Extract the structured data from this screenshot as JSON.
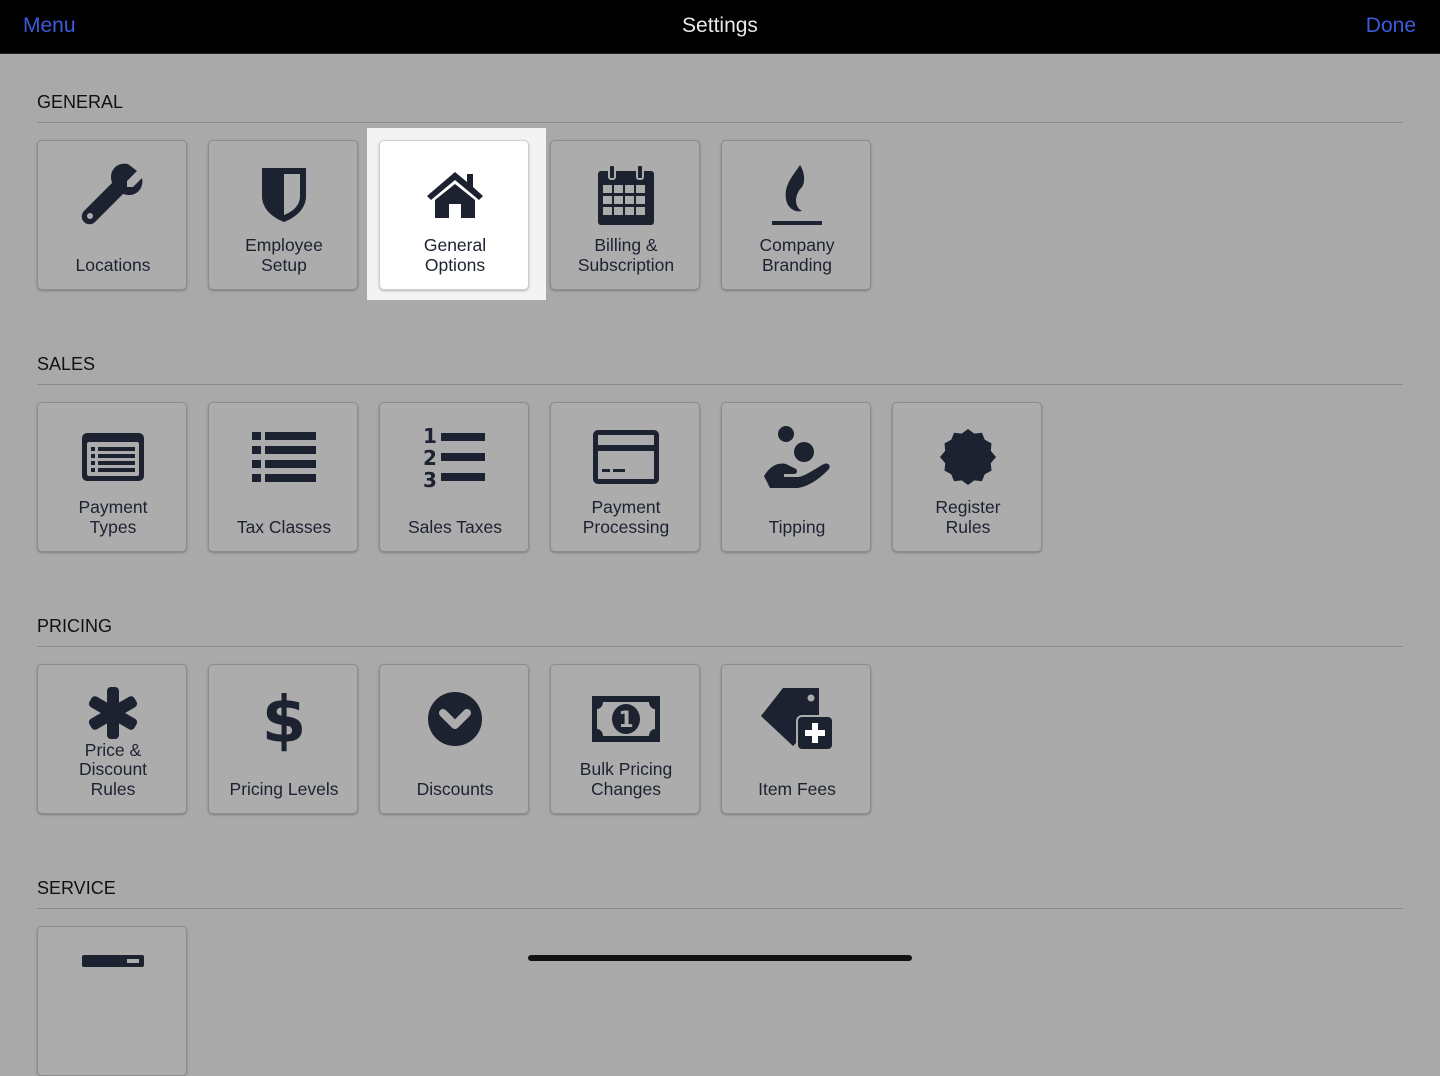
{
  "header": {
    "menu_label": "Menu",
    "title": "Settings",
    "done_label": "Done"
  },
  "colors": {
    "accent": "#3b5bd9",
    "icon": "#1d2230",
    "background": "#a9a9a9"
  },
  "sections": {
    "general": {
      "title": "GENERAL",
      "items": [
        {
          "label": "Locations",
          "icon": "wrench-icon"
        },
        {
          "label": "Employee\nSetup",
          "icon": "shield-icon"
        },
        {
          "label": "General\nOptions",
          "icon": "home-icon",
          "selected": true
        },
        {
          "label": "Billing &\nSubscription",
          "icon": "calendar-icon"
        },
        {
          "label": "Company\nBranding",
          "icon": "flame-icon"
        }
      ]
    },
    "sales": {
      "title": "SALES",
      "items": [
        {
          "label": "Payment\nTypes",
          "icon": "list-card-icon"
        },
        {
          "label": "Tax Classes",
          "icon": "list-icon"
        },
        {
          "label": "Sales Taxes",
          "icon": "numbered-list-icon"
        },
        {
          "label": "Payment\nProcessing",
          "icon": "credit-card-icon"
        },
        {
          "label": "Tipping",
          "icon": "hand-coins-icon"
        },
        {
          "label": "Register\nRules",
          "icon": "badge-icon"
        }
      ]
    },
    "pricing": {
      "title": "PRICING",
      "items": [
        {
          "label": "Price &\nDiscount\nRules",
          "icon": "asterisk-icon"
        },
        {
          "label": "Pricing Levels",
          "icon": "dollar-icon"
        },
        {
          "label": "Discounts",
          "icon": "chevron-circle-icon"
        },
        {
          "label": "Bulk Pricing\nChanges",
          "icon": "banknote-icon"
        },
        {
          "label": "Item Fees",
          "icon": "tag-plus-icon"
        }
      ]
    },
    "service": {
      "title": "SERVICE",
      "items": [
        {
          "label": "",
          "icon": "bar-icon"
        }
      ]
    }
  }
}
